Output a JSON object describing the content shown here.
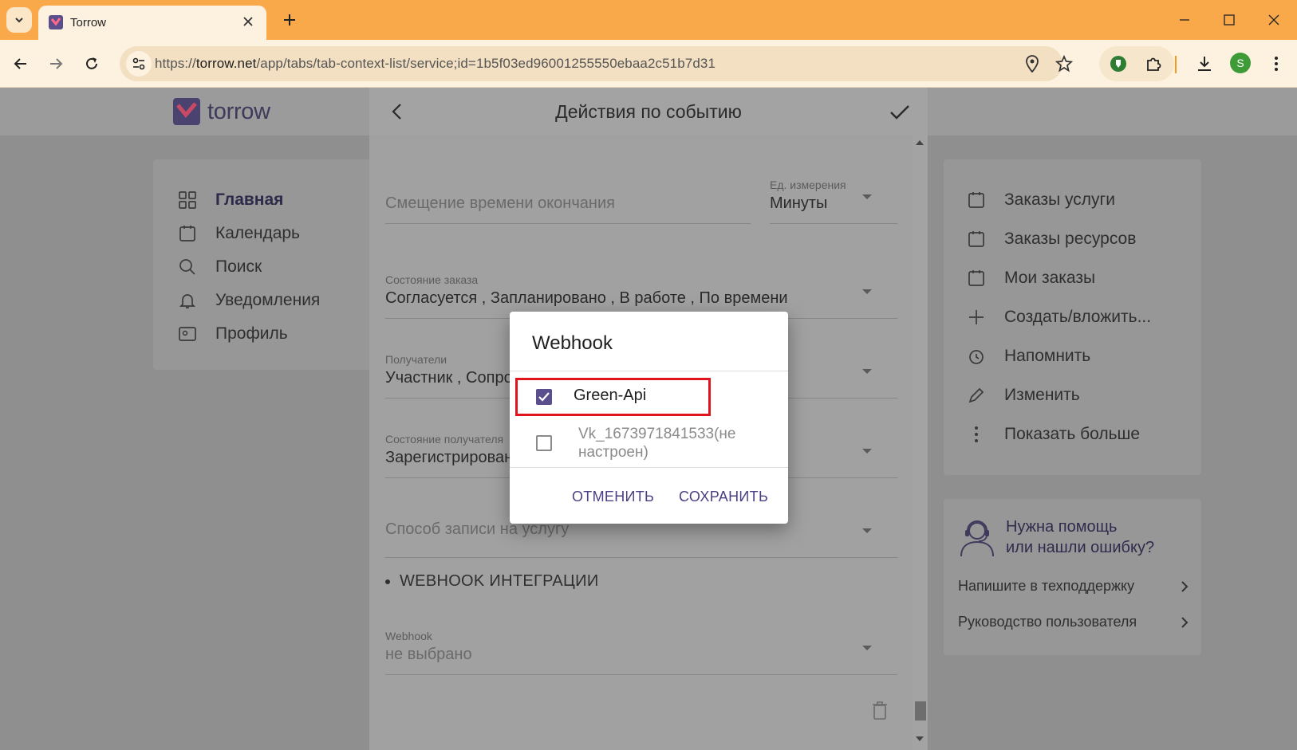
{
  "browser": {
    "tab_title": "Torrow",
    "url_prefix": "https://",
    "url_host": "torrow.net",
    "url_path": "/app/tabs/tab-context-list/service;id=1b5f03ed96001255550ebaa2c51b7d31",
    "profile_initial": "S",
    "chrome_color": "#f9a94a"
  },
  "app": {
    "logo_text": "torrow",
    "brand_color": "#5b4e8c",
    "left_menu": [
      {
        "label": "Главная",
        "icon": "grid-icon"
      },
      {
        "label": "Календарь",
        "icon": "calendar-icon"
      },
      {
        "label": "Поиск",
        "icon": "search-icon"
      },
      {
        "label": "Уведомления",
        "icon": "bell-icon"
      },
      {
        "label": "Профиль",
        "icon": "profile-icon"
      }
    ],
    "right_menu": [
      {
        "label": "Заказы услуги",
        "icon": "calendar-icon"
      },
      {
        "label": "Заказы ресурсов",
        "icon": "calendar-icon"
      },
      {
        "label": "Мои заказы",
        "icon": "calendar-icon"
      },
      {
        "label": "Создать/вложить...",
        "icon": "plus-icon"
      },
      {
        "label": "Напомнить",
        "icon": "clock-icon"
      },
      {
        "label": "Изменить",
        "icon": "pencil-icon"
      },
      {
        "label": "Показать больше",
        "icon": "more-vertical-icon"
      }
    ],
    "help": {
      "title_line1": "Нужна помощь",
      "title_line2": "или нашли ошибку?",
      "link_support": "Напишите в техподдержку",
      "link_guide": "Руководство пользователя"
    }
  },
  "panel": {
    "title": "Действия по событию",
    "end_offset_placeholder": "Смещение времени окончания",
    "unit_label": "Ед. измерения",
    "unit_value": "Минуты",
    "order_state_label": "Состояние заказа",
    "order_state_value": "Согласуется , Запланировано , В работе , По времени",
    "recipients_label": "Получатели",
    "recipients_value": "Участник , Сопро",
    "recipient_state_label": "Состояние получателя",
    "recipient_state_value": "Зарегистрирован",
    "signup_method_placeholder": "Способ записи на услугу",
    "section_title": "WEBHOOK ИНТЕГРАЦИИ",
    "webhook_label": "Webhook",
    "webhook_value": "не выбрано"
  },
  "dialog": {
    "title": "Webhook",
    "options": [
      {
        "label": "Green-Api",
        "checked": true
      },
      {
        "label_line1": "Vk_1673971841533(не",
        "label_line2": "настроен)",
        "checked": false
      }
    ],
    "cancel": "ОТМЕНИТЬ",
    "save": "СОХРАНИТЬ"
  }
}
